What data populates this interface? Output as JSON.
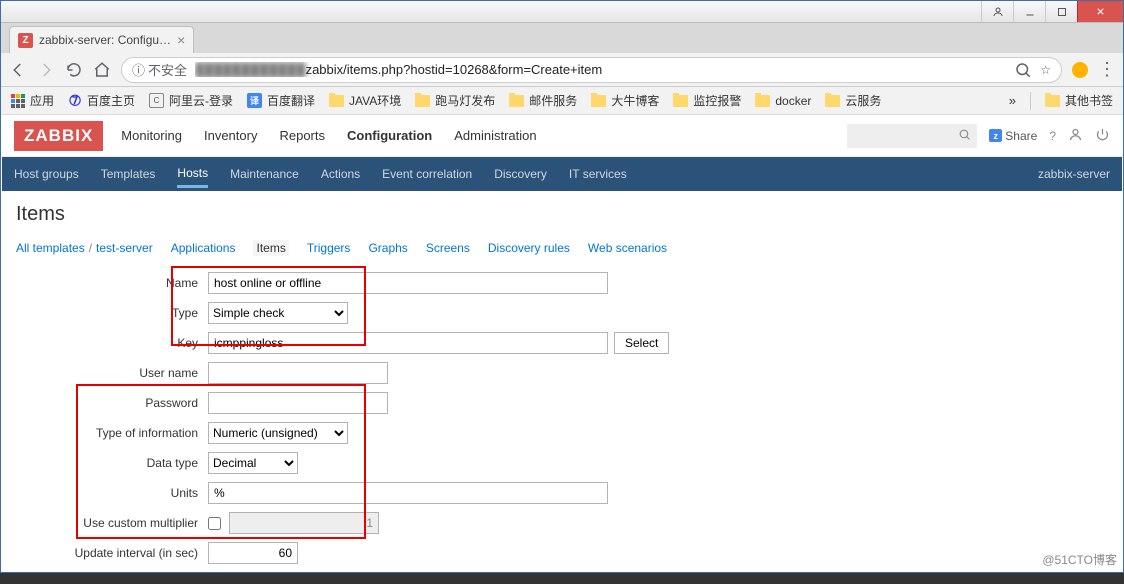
{
  "os": {
    "min": "—"
  },
  "browser": {
    "tab_title": "zabbix-server: Configu…",
    "tab_favicon_letter": "Z",
    "url_prefix": "不安全",
    "url_host_hidden": "████████████",
    "url_path": "zabbix/items.php?hostid=10268&form=Create+item"
  },
  "bookmarks": {
    "apps": "应用",
    "items": [
      {
        "icon": "baidu",
        "label": "百度主页"
      },
      {
        "icon": "ali",
        "label": "阿里云-登录"
      },
      {
        "icon": "trans",
        "label": "百度翻译"
      },
      {
        "icon": "folder",
        "label": "JAVA环境"
      },
      {
        "icon": "folder",
        "label": "跑马灯发布"
      },
      {
        "icon": "folder",
        "label": "邮件服务"
      },
      {
        "icon": "folder",
        "label": "大牛博客"
      },
      {
        "icon": "folder",
        "label": "监控报警"
      },
      {
        "icon": "folder",
        "label": "docker"
      },
      {
        "icon": "folder",
        "label": "云服务"
      }
    ],
    "overflow": "»",
    "other": "其他书签"
  },
  "zabbix": {
    "logo": "ZABBIX",
    "topnav": [
      "Monitoring",
      "Inventory",
      "Reports",
      "Configuration",
      "Administration"
    ],
    "topnav_active": "Configuration",
    "share": "Share",
    "subnav": [
      "Host groups",
      "Templates",
      "Hosts",
      "Maintenance",
      "Actions",
      "Event correlation",
      "Discovery",
      "IT services"
    ],
    "subnav_active": "Hosts",
    "subnav_right": "zabbix-server",
    "page_title": "Items",
    "breadcrumb": {
      "all_templates": "All templates",
      "test_server": "test-server",
      "applications": "Applications",
      "items": "Items",
      "triggers": "Triggers",
      "graphs": "Graphs",
      "screens": "Screens",
      "discovery": "Discovery rules",
      "web": "Web scenarios"
    },
    "form": {
      "name_label": "Name",
      "name_value": "host online or offline",
      "type_label": "Type",
      "type_value": "Simple check",
      "key_label": "Key",
      "key_value": "icmppingloss",
      "key_select": "Select",
      "username_label": "User name",
      "username_value": "",
      "password_label": "Password",
      "password_value": "",
      "typeinfo_label": "Type of information",
      "typeinfo_value": "Numeric (unsigned)",
      "datatype_label": "Data type",
      "datatype_value": "Decimal",
      "units_label": "Units",
      "units_value": "%",
      "multiplier_label": "Use custom multiplier",
      "multiplier_checked": false,
      "multiplier_value": "1",
      "interval_label": "Update interval (in sec)",
      "interval_value": "60"
    }
  },
  "watermark": "@51CTO博客"
}
